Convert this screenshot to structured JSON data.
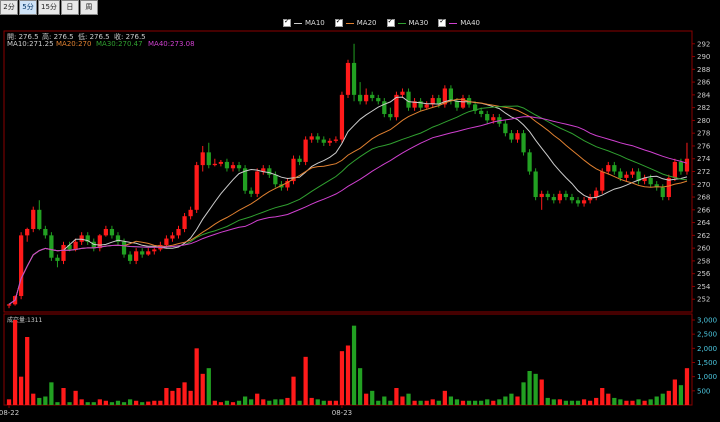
{
  "toolbar": {
    "tabs": [
      {
        "label": "2分",
        "active": false
      },
      {
        "label": "5分",
        "active": true
      },
      {
        "label": "15分",
        "active": false
      },
      {
        "label": "日",
        "active": false
      },
      {
        "label": "周",
        "active": false
      }
    ]
  },
  "legend": [
    {
      "label": "MA10",
      "color": "#cccccc"
    },
    {
      "label": "MA20",
      "color": "#e08030"
    },
    {
      "label": "MA30",
      "color": "#30a030"
    },
    {
      "label": "MA40",
      "color": "#d040d0"
    }
  ],
  "info": {
    "open": "開: 276.5",
    "high": "高: 276.5",
    "low": "低: 276.5",
    "close": "收: 276.5",
    "ma10": "MA10:271.25",
    "ma20": "MA20:270",
    "ma30": "MA30:270.47",
    "ma40": "MA40:273.08",
    "ma10_color": "#cccccc",
    "ma20_color": "#e08030",
    "ma30_color": "#30a030",
    "ma40_color": "#d040d0"
  },
  "volume_label": "成交量:1311",
  "chart_data": {
    "type": "candlestick",
    "price_ylim": [
      250,
      294
    ],
    "price_ticks": [
      "252",
      "254",
      "256",
      "258",
      "260",
      "262",
      "264",
      "266",
      "268",
      "270",
      "272",
      "274",
      "276",
      "278",
      "280",
      "282",
      "284",
      "286",
      "288",
      "290",
      "292"
    ],
    "volume_ylim": [
      0,
      3000
    ],
    "volume_ticks": [
      "500",
      "1,000",
      "1,500",
      "2,000",
      "2,500",
      "3,000"
    ],
    "x_labels": [
      "08-22",
      "08-23"
    ],
    "x_label_index": [
      0,
      55
    ],
    "candles": [
      [
        251,
        251.2,
        250.6,
        251.3,
        200
      ],
      [
        251.2,
        252.5,
        251,
        252.6,
        3000
      ],
      [
        252.5,
        262,
        252,
        262.5,
        1000
      ],
      [
        262,
        263,
        261,
        263.2,
        2400
      ],
      [
        263,
        266,
        262.5,
        266.5,
        400
      ],
      [
        266,
        263,
        262.8,
        267.5,
        250
      ],
      [
        263,
        262,
        261.5,
        263.5,
        300
      ],
      [
        262,
        258.5,
        258,
        262.5,
        800
      ],
      [
        258.5,
        258,
        257,
        259,
        100
      ],
      [
        258,
        260.5,
        257.5,
        261,
        600
      ],
      [
        260.5,
        259.8,
        259.5,
        261,
        100
      ],
      [
        259.8,
        261,
        259.5,
        261.5,
        500
      ],
      [
        261,
        262,
        260.5,
        262.5,
        200
      ],
      [
        262,
        261,
        260.5,
        262.5,
        100
      ],
      [
        261,
        260,
        259.5,
        261.5,
        100
      ],
      [
        260,
        262,
        259.5,
        262.2,
        200
      ],
      [
        262,
        263,
        261.8,
        263.5,
        150
      ],
      [
        263,
        262,
        261.5,
        263.5,
        100
      ],
      [
        262,
        261,
        260.5,
        262.5,
        150
      ],
      [
        261,
        259,
        258.5,
        261.5,
        100
      ],
      [
        259,
        258,
        257.5,
        259.5,
        200
      ],
      [
        258,
        259.5,
        257.5,
        260,
        150
      ],
      [
        259.5,
        259,
        258.5,
        260,
        100
      ],
      [
        259,
        259.5,
        258.8,
        260,
        120
      ],
      [
        259.5,
        259.8,
        259,
        260.2,
        150
      ],
      [
        259.8,
        260.5,
        259.5,
        261,
        150
      ],
      [
        260.5,
        261.5,
        260,
        262,
        600
      ],
      [
        261.5,
        262,
        261,
        262.5,
        500
      ],
      [
        262,
        263,
        261.5,
        263.5,
        600
      ],
      [
        263,
        265,
        262.5,
        265.5,
        800
      ],
      [
        265,
        266,
        264.5,
        266.5,
        500
      ],
      [
        266,
        273,
        265.5,
        273.5,
        2000
      ],
      [
        273,
        275,
        272,
        276,
        1100
      ],
      [
        275,
        273,
        272.5,
        276.5,
        1300
      ],
      [
        273,
        273.2,
        272.8,
        274,
        150
      ],
      [
        273.2,
        273.5,
        272.8,
        273.8,
        100
      ],
      [
        273.5,
        272.5,
        272,
        274,
        150
      ],
      [
        272.5,
        273,
        272,
        273.5,
        100
      ],
      [
        273,
        272.5,
        272,
        273.5,
        150
      ],
      [
        272.5,
        269,
        268.5,
        273,
        300
      ],
      [
        269,
        268.5,
        268,
        269.5,
        200
      ],
      [
        268.5,
        272,
        268,
        272.5,
        400
      ],
      [
        272,
        272.5,
        271.5,
        273,
        200
      ],
      [
        272.5,
        271.5,
        271,
        273,
        150
      ],
      [
        271.5,
        270,
        269.5,
        272,
        200
      ],
      [
        270,
        269.5,
        269,
        270.5,
        200
      ],
      [
        269.5,
        270.5,
        269,
        271,
        250
      ],
      [
        270.5,
        274,
        270,
        274.5,
        1000
      ],
      [
        274,
        273.5,
        273,
        274.5,
        150
      ],
      [
        273.5,
        277,
        273,
        277.5,
        1700
      ],
      [
        277,
        277.5,
        276.5,
        278,
        250
      ],
      [
        277.5,
        277,
        276.5,
        278,
        200
      ],
      [
        277,
        276.5,
        276,
        277.5,
        150
      ],
      [
        276.5,
        276.8,
        276,
        277.2,
        150
      ],
      [
        276.8,
        277,
        276.5,
        277.5,
        150
      ],
      [
        277,
        284,
        276.5,
        284.5,
        1900
      ],
      [
        284,
        289,
        283.5,
        289.5,
        2100
      ],
      [
        289,
        284,
        283,
        292,
        2800
      ],
      [
        284,
        283,
        282.5,
        286,
        1300
      ],
      [
        283,
        284,
        282.5,
        285,
        400
      ],
      [
        284,
        283.5,
        283,
        284.5,
        500
      ],
      [
        283.5,
        283,
        282.5,
        284,
        150
      ],
      [
        283,
        281,
        280.5,
        283.5,
        300
      ],
      [
        281,
        280.5,
        280,
        282,
        150
      ],
      [
        280.5,
        284,
        280,
        284.5,
        600
      ],
      [
        284,
        284.5,
        283.5,
        285,
        300
      ],
      [
        284.5,
        282,
        281.5,
        285,
        400
      ],
      [
        282,
        283,
        281.5,
        283.5,
        150
      ],
      [
        283,
        282,
        281.5,
        283.5,
        150
      ],
      [
        282,
        282.5,
        281.8,
        283,
        150
      ],
      [
        282.5,
        283.5,
        282,
        284,
        200
      ],
      [
        283.5,
        282.5,
        282,
        284,
        150
      ],
      [
        282.5,
        285,
        282,
        285.5,
        500
      ],
      [
        285,
        283,
        282.5,
        285.5,
        300
      ],
      [
        283,
        282,
        281.5,
        283.5,
        200
      ],
      [
        282,
        283.5,
        281.8,
        284,
        150
      ],
      [
        283.5,
        282.5,
        282,
        284,
        150
      ],
      [
        282.5,
        281.5,
        281,
        283,
        150
      ],
      [
        281.5,
        281,
        280.5,
        282,
        150
      ],
      [
        281,
        280,
        279.5,
        281.5,
        200
      ],
      [
        280,
        280.5,
        279.5,
        281,
        150
      ],
      [
        280.5,
        279.5,
        279,
        281,
        200
      ],
      [
        279.5,
        278,
        277.5,
        280,
        300
      ],
      [
        278,
        277,
        276.5,
        278.5,
        400
      ],
      [
        277,
        278,
        276.5,
        278.5,
        300
      ],
      [
        278,
        275,
        274.5,
        278.5,
        800
      ],
      [
        275,
        272,
        271.5,
        275.5,
        1200
      ],
      [
        272,
        268,
        267.5,
        272.5,
        1100
      ],
      [
        268,
        268.5,
        266,
        269,
        900
      ],
      [
        268.5,
        268,
        267.5,
        269,
        250
      ],
      [
        268,
        267.5,
        267,
        268.5,
        200
      ],
      [
        267.5,
        268.5,
        267,
        269,
        200
      ],
      [
        268.5,
        268,
        267.5,
        269,
        150
      ],
      [
        268,
        267.5,
        267,
        268.5,
        150
      ],
      [
        267.5,
        267,
        266.5,
        268,
        150
      ],
      [
        267,
        267.5,
        266.5,
        268,
        200
      ],
      [
        267.5,
        268,
        267,
        268.5,
        150
      ],
      [
        268,
        269,
        267.5,
        269.5,
        250
      ],
      [
        269,
        272,
        268.5,
        272.5,
        600
      ],
      [
        272,
        273,
        271.5,
        273.5,
        400
      ],
      [
        273,
        272,
        271.5,
        273.5,
        250
      ],
      [
        272,
        271,
        270.5,
        272.5,
        200
      ],
      [
        271,
        271.5,
        270.5,
        272,
        150
      ],
      [
        271.5,
        272,
        271,
        272.5,
        150
      ],
      [
        272,
        270.5,
        270,
        272.5,
        200
      ],
      [
        270.5,
        271,
        270,
        271.5,
        150
      ],
      [
        271,
        270,
        269.5,
        271.5,
        200
      ],
      [
        270,
        269.5,
        269,
        270.5,
        300
      ],
      [
        269.5,
        268,
        267.5,
        270,
        400
      ],
      [
        268,
        271,
        267.5,
        271.5,
        500
      ],
      [
        271,
        273.5,
        270.5,
        274,
        900
      ],
      [
        273.5,
        272,
        271.5,
        274,
        700
      ],
      [
        272,
        274,
        271.5,
        276.5,
        1300
      ]
    ]
  }
}
